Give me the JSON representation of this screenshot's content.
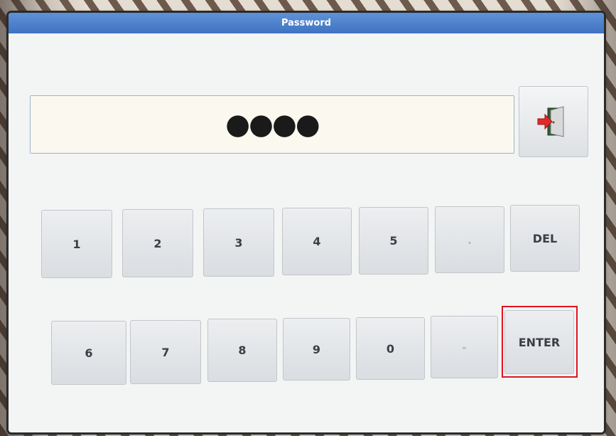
{
  "window": {
    "title": "Password"
  },
  "password": {
    "masked_value": "●●●●"
  },
  "exit_button": {
    "icon": "exit-door-icon"
  },
  "keypad": {
    "row1": [
      "1",
      "2",
      "3",
      "4",
      "5",
      ".",
      "DEL"
    ],
    "row2": [
      "6",
      "7",
      "8",
      "9",
      "0",
      "-",
      "ENTER"
    ]
  },
  "colors": {
    "title_bar": "#4a7fcc",
    "highlight": "#e0141f"
  }
}
